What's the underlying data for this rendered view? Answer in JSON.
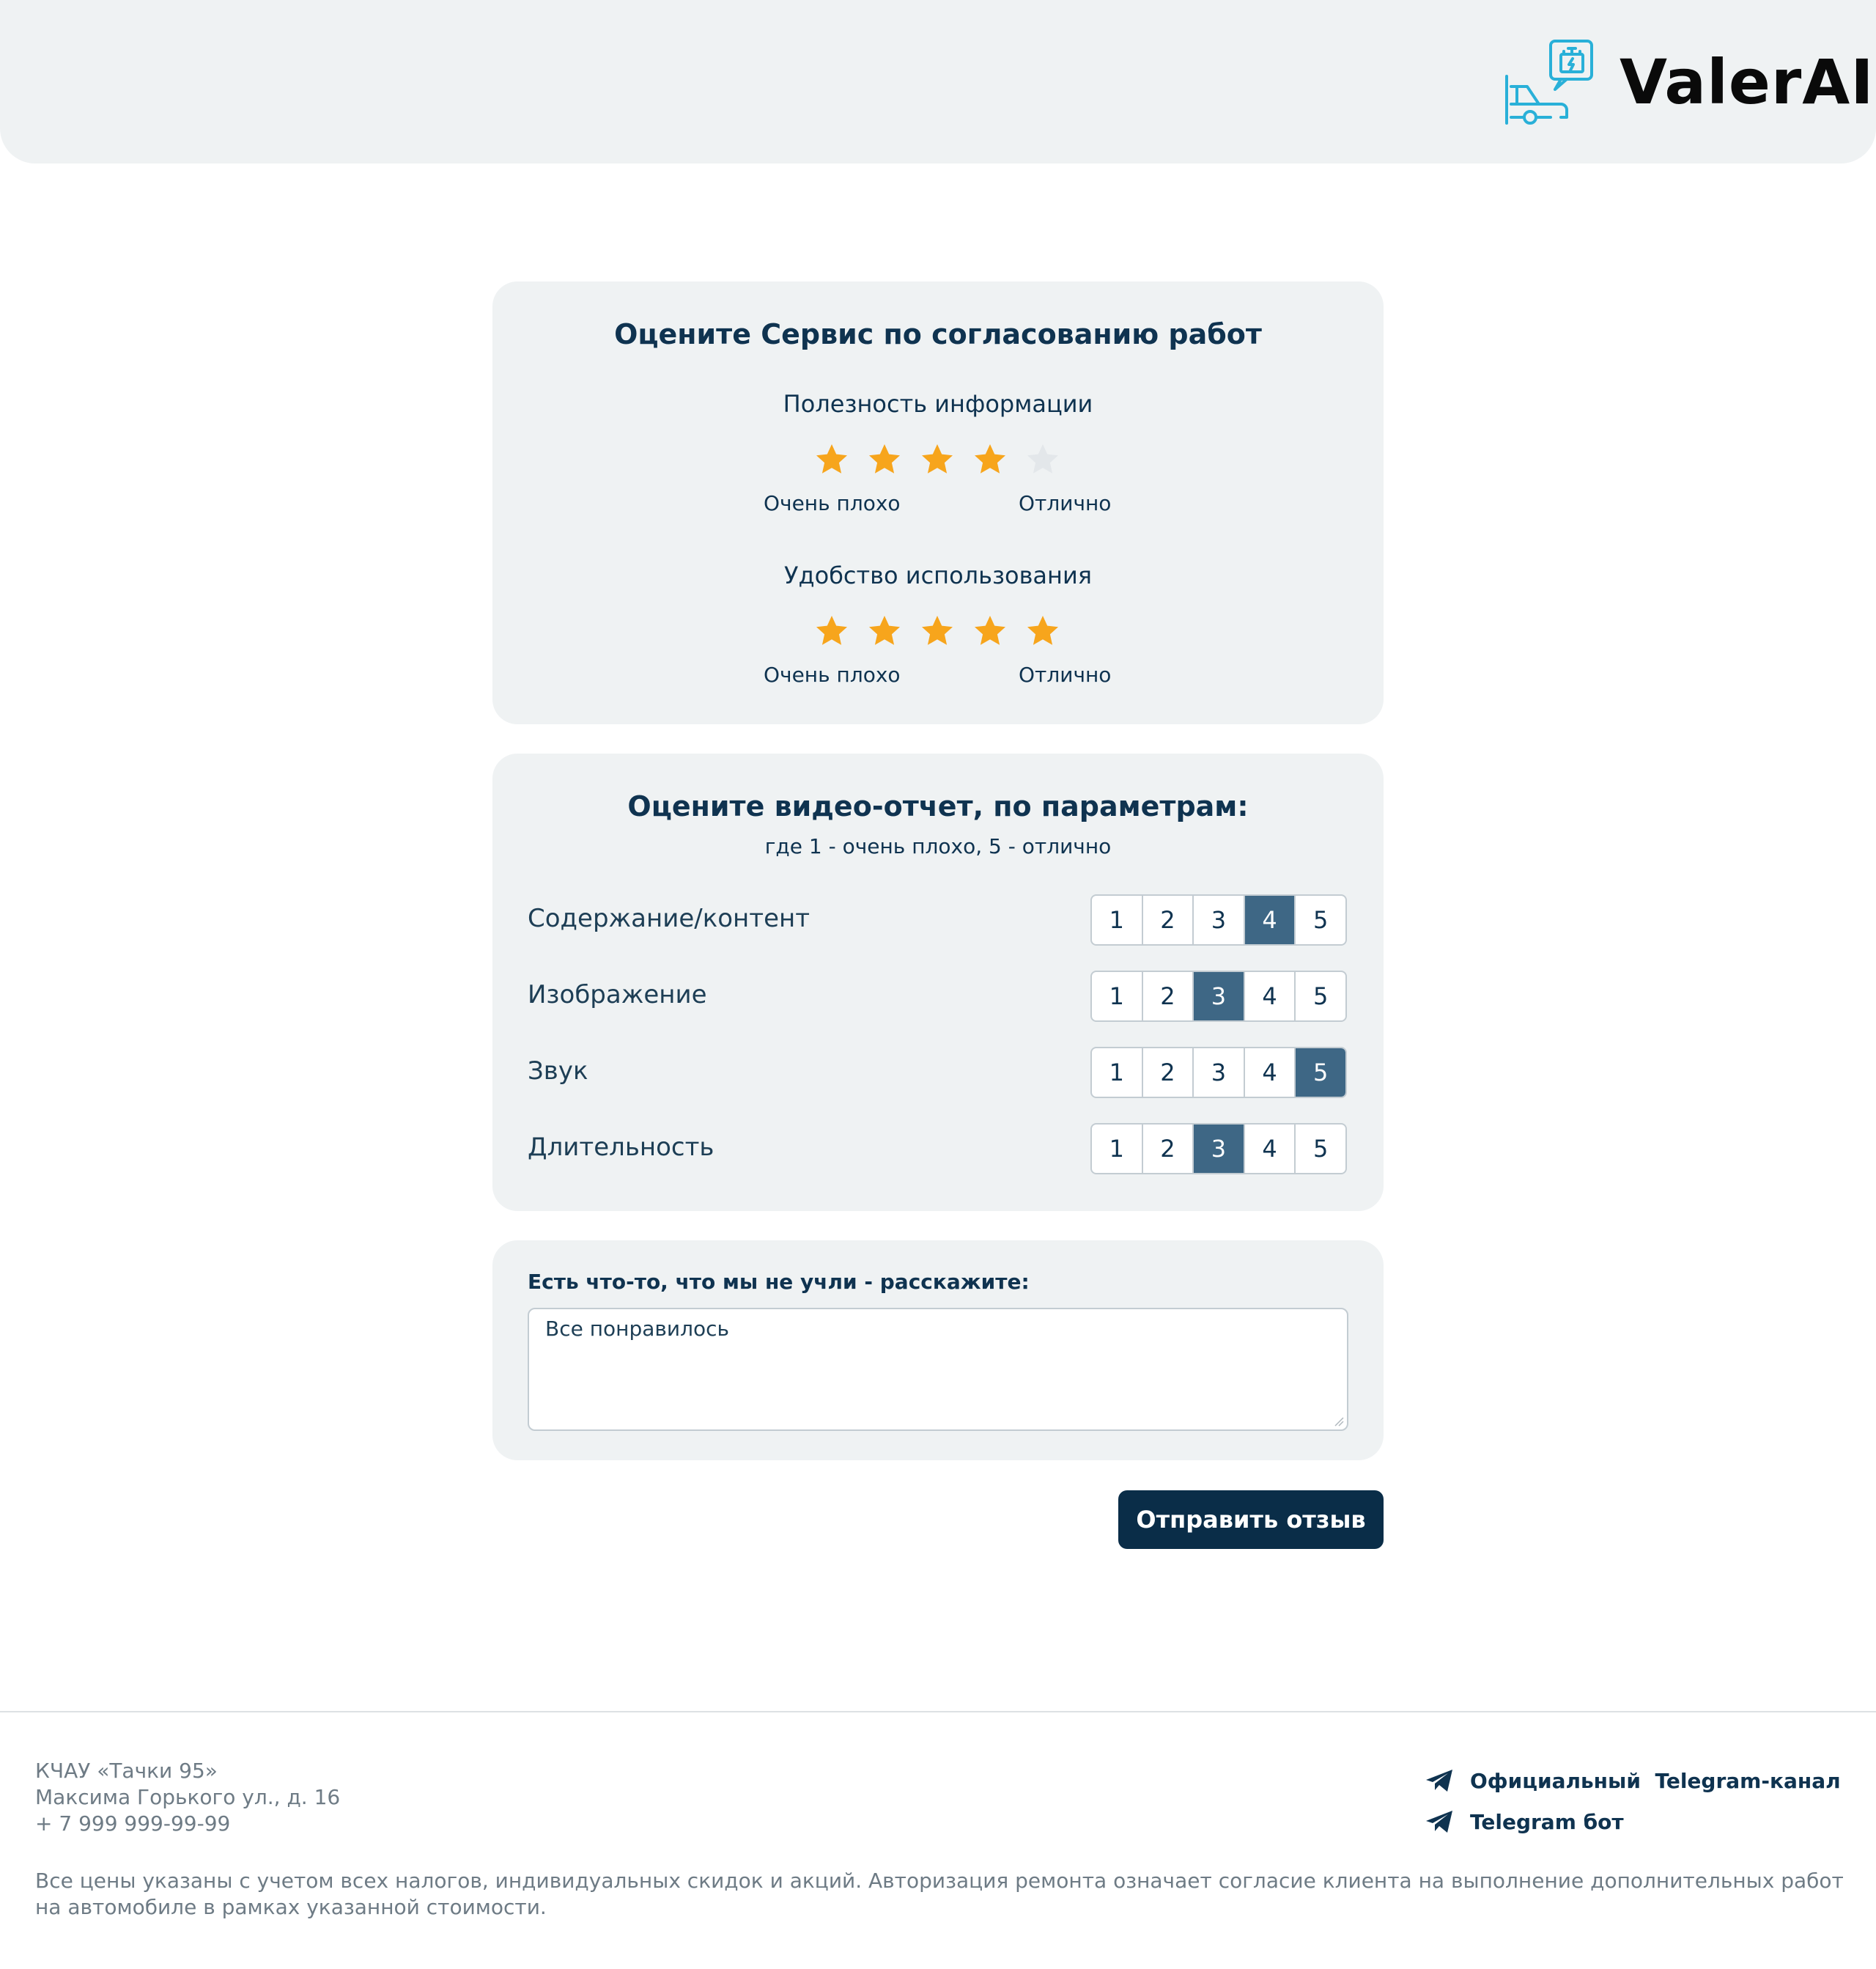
{
  "brand": {
    "name": "ValerAI",
    "accent": "#29b0d8"
  },
  "service_card": {
    "title": "Оцените Сервис по согласованию работ",
    "questions": [
      {
        "label": "Полезность информации",
        "rating": 4,
        "max": 5,
        "low_label": "Очень плохо",
        "high_label": "Отлично"
      },
      {
        "label": "Удобство использования",
        "rating": 5,
        "max": 5,
        "low_label": "Очень плохо",
        "high_label": "Отлично"
      }
    ],
    "star_color": "#f7a51c",
    "star_empty_color": "#e3e7ea"
  },
  "video_card": {
    "title": "Оцените видео-отчет, по параметрам:",
    "subtitle": "где 1 - очень плохо, 5 - отлично",
    "options": [
      "1",
      "2",
      "3",
      "4",
      "5"
    ],
    "rows": [
      {
        "label": "Содержание/контент",
        "selected": 4
      },
      {
        "label": "Изображение",
        "selected": 3
      },
      {
        "label": "Звук",
        "selected": 5
      },
      {
        "label": "Длительность",
        "selected": 3
      }
    ],
    "selected_color": "#3e6785"
  },
  "comment_card": {
    "label": "Есть что-то, что мы не учли - расскажите:",
    "value": "Все понравилось"
  },
  "submit_label": "Отправить отзыв",
  "footer": {
    "company": "КЧАУ «Тачки 95»",
    "address": "Максима Горького ул., д. 16",
    "phone": "+ 7 999 999-99-99",
    "links": [
      "Официальный  Telegram-канал",
      "Telegram бот"
    ],
    "disclaimer": "Все цены указаны с учетом всех налогов, индивидуальных скидок и акций. Авторизация ремонта означает согласие клиента на выполнение дополнительных работ на автомобиле в рамках указанной стоимости."
  }
}
